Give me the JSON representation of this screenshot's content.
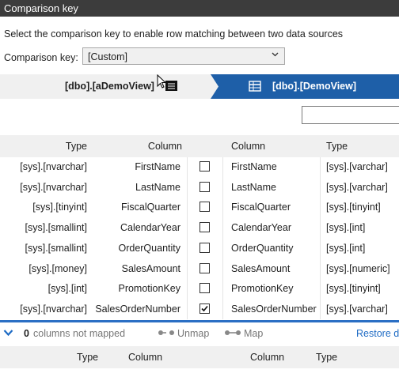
{
  "window": {
    "title": "Comparison key"
  },
  "instructions": "Select the comparison key to enable row matching between two data sources",
  "comparison_key": {
    "label": "Comparison key:",
    "value": "[Custom]"
  },
  "sources": {
    "left": "[dbo].[aDemoView]",
    "right": "[dbo].[DemoView]"
  },
  "filter": {
    "value": ""
  },
  "columns": {
    "left_type": "Type",
    "left_column": "Column",
    "right_column": "Column",
    "right_type": "Type"
  },
  "rows": [
    {
      "left_type": "[sys].[nvarchar]",
      "left_column": "FirstName",
      "checked": false,
      "right_column": "FirstName",
      "right_type": "[sys].[varchar]"
    },
    {
      "left_type": "[sys].[nvarchar]",
      "left_column": "LastName",
      "checked": false,
      "right_column": "LastName",
      "right_type": "[sys].[varchar]"
    },
    {
      "left_type": "[sys].[tinyint]",
      "left_column": "FiscalQuarter",
      "checked": false,
      "right_column": "FiscalQuarter",
      "right_type": "[sys].[tinyint]"
    },
    {
      "left_type": "[sys].[smallint]",
      "left_column": "CalendarYear",
      "checked": false,
      "right_column": "CalendarYear",
      "right_type": "[sys].[int]"
    },
    {
      "left_type": "[sys].[smallint]",
      "left_column": "OrderQuantity",
      "checked": false,
      "right_column": "OrderQuantity",
      "right_type": "[sys].[int]"
    },
    {
      "left_type": "[sys].[money]",
      "left_column": "SalesAmount",
      "checked": false,
      "right_column": "SalesAmount",
      "right_type": "[sys].[numeric]"
    },
    {
      "left_type": "[sys].[int]",
      "left_column": "PromotionKey",
      "checked": false,
      "right_column": "PromotionKey",
      "right_type": "[sys].[tinyint]"
    },
    {
      "left_type": "[sys].[nvarchar]",
      "left_column": "SalesOrderNumber",
      "checked": true,
      "right_column": "SalesOrderNumber",
      "right_type": "[sys].[varchar]"
    }
  ],
  "status": {
    "count": "0",
    "count_suffix": "columns not mapped",
    "unmap_label": "Unmap",
    "map_label": "Map",
    "restore_label": "Restore d"
  },
  "unmapped_columns": {
    "left_type": "Type",
    "left_column": "Column",
    "right_column": "Column",
    "right_type": "Type"
  },
  "colors": {
    "accent": "#1e5fa8",
    "titlebar": "#3c3c3c",
    "link": "#1e6bc4"
  }
}
